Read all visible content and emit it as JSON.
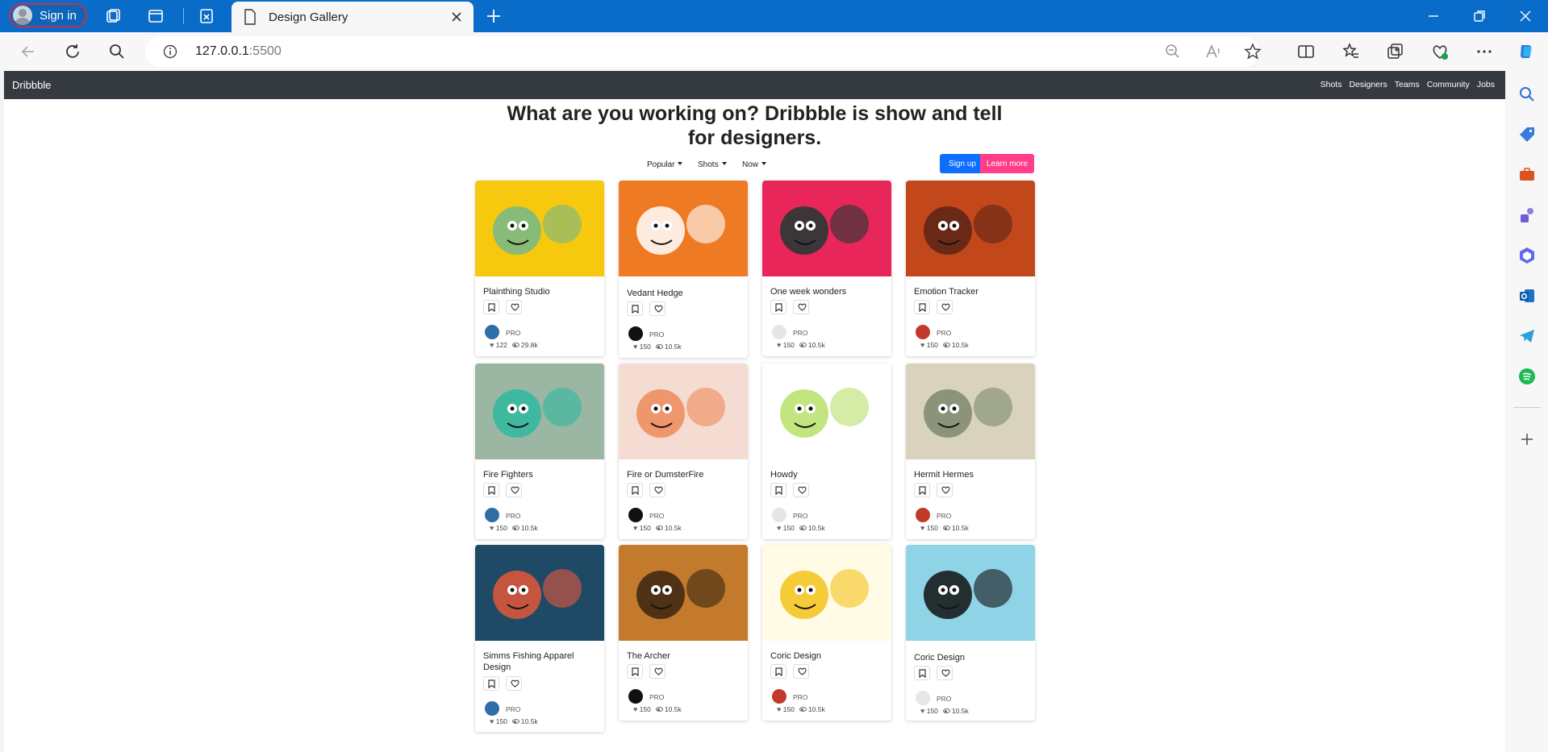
{
  "browser": {
    "signin_label": "Sign in",
    "tab_title": "Design Gallery",
    "url_host": "127.0.0.1",
    "url_port": ":5500"
  },
  "site": {
    "brand": "Dribbble",
    "nav": [
      "Shots",
      "Designers",
      "Teams",
      "Community",
      "Jobs"
    ],
    "headline": "What are you working on? Dribbble is show and tell for designers.",
    "filters": [
      "Popular",
      "Shots",
      "Now"
    ],
    "signup_label": "Sign up",
    "learn_more_label": "Learn more"
  },
  "cards": [
    {
      "title": "Plainthing Studio",
      "badge": "PRO",
      "likes": "122",
      "views": "29.8k",
      "thumb_color": "#f6c90e",
      "accent": "#74b98a",
      "avatar": "#2e6fa8"
    },
    {
      "title": "Vedant Hedge",
      "badge": "PRO",
      "likes": "150",
      "views": "10.5k",
      "thumb_color": "#ef7a24",
      "accent": "#ffffff",
      "avatar": "#111111"
    },
    {
      "title": "One week wonders",
      "badge": "PRO",
      "likes": "150",
      "views": "10.5k",
      "thumb_color": "#e8265a",
      "accent": "#1f3a33",
      "avatar": "#e6e6e6"
    },
    {
      "title": "Emotion Tracker",
      "badge": "PRO",
      "likes": "150",
      "views": "10.5k",
      "thumb_color": "#c2471b",
      "accent": "#5b2416",
      "avatar": "#c0392b"
    },
    {
      "title": "Fire Fighters",
      "badge": "PRO",
      "likes": "150",
      "views": "10.5k",
      "thumb_color": "#9bb6a3",
      "accent": "#2fb9a0",
      "avatar": "#2e6fa8"
    },
    {
      "title": "Fire or DumsterFire",
      "badge": "PRO",
      "likes": "150",
      "views": "10.5k",
      "thumb_color": "#f4dcd2",
      "accent": "#ee8a5a",
      "avatar": "#111111"
    },
    {
      "title": "Howdy",
      "badge": "PRO",
      "likes": "150",
      "views": "10.5k",
      "thumb_color": "#ffffff",
      "accent": "#b8e06a",
      "avatar": "#e6e6e6"
    },
    {
      "title": "Hermit Hermes",
      "badge": "PRO",
      "likes": "150",
      "views": "10.5k",
      "thumb_color": "#d9d2bd",
      "accent": "#7c8a6e",
      "avatar": "#c0392b"
    },
    {
      "title": "Simms Fishing Apparel Design",
      "badge": "PRO",
      "likes": "150",
      "views": "10.5k",
      "thumb_color": "#1f4a66",
      "accent": "#e4573a",
      "avatar": "#2e6fa8"
    },
    {
      "title": "The Archer",
      "badge": "PRO",
      "likes": "150",
      "views": "10.5k",
      "thumb_color": "#c47a2c",
      "accent": "#3b2612",
      "avatar": "#111111"
    },
    {
      "title": "Coric Design",
      "badge": "PRO",
      "likes": "150",
      "views": "10.5k",
      "thumb_color": "#fffbe5",
      "accent": "#f5c21a",
      "avatar": "#c0392b"
    },
    {
      "title": "Coric Design",
      "badge": "PRO",
      "likes": "150",
      "views": "10.5k",
      "thumb_color": "#8fd3e6",
      "accent": "#111111",
      "avatar": "#e6e6e6"
    }
  ]
}
